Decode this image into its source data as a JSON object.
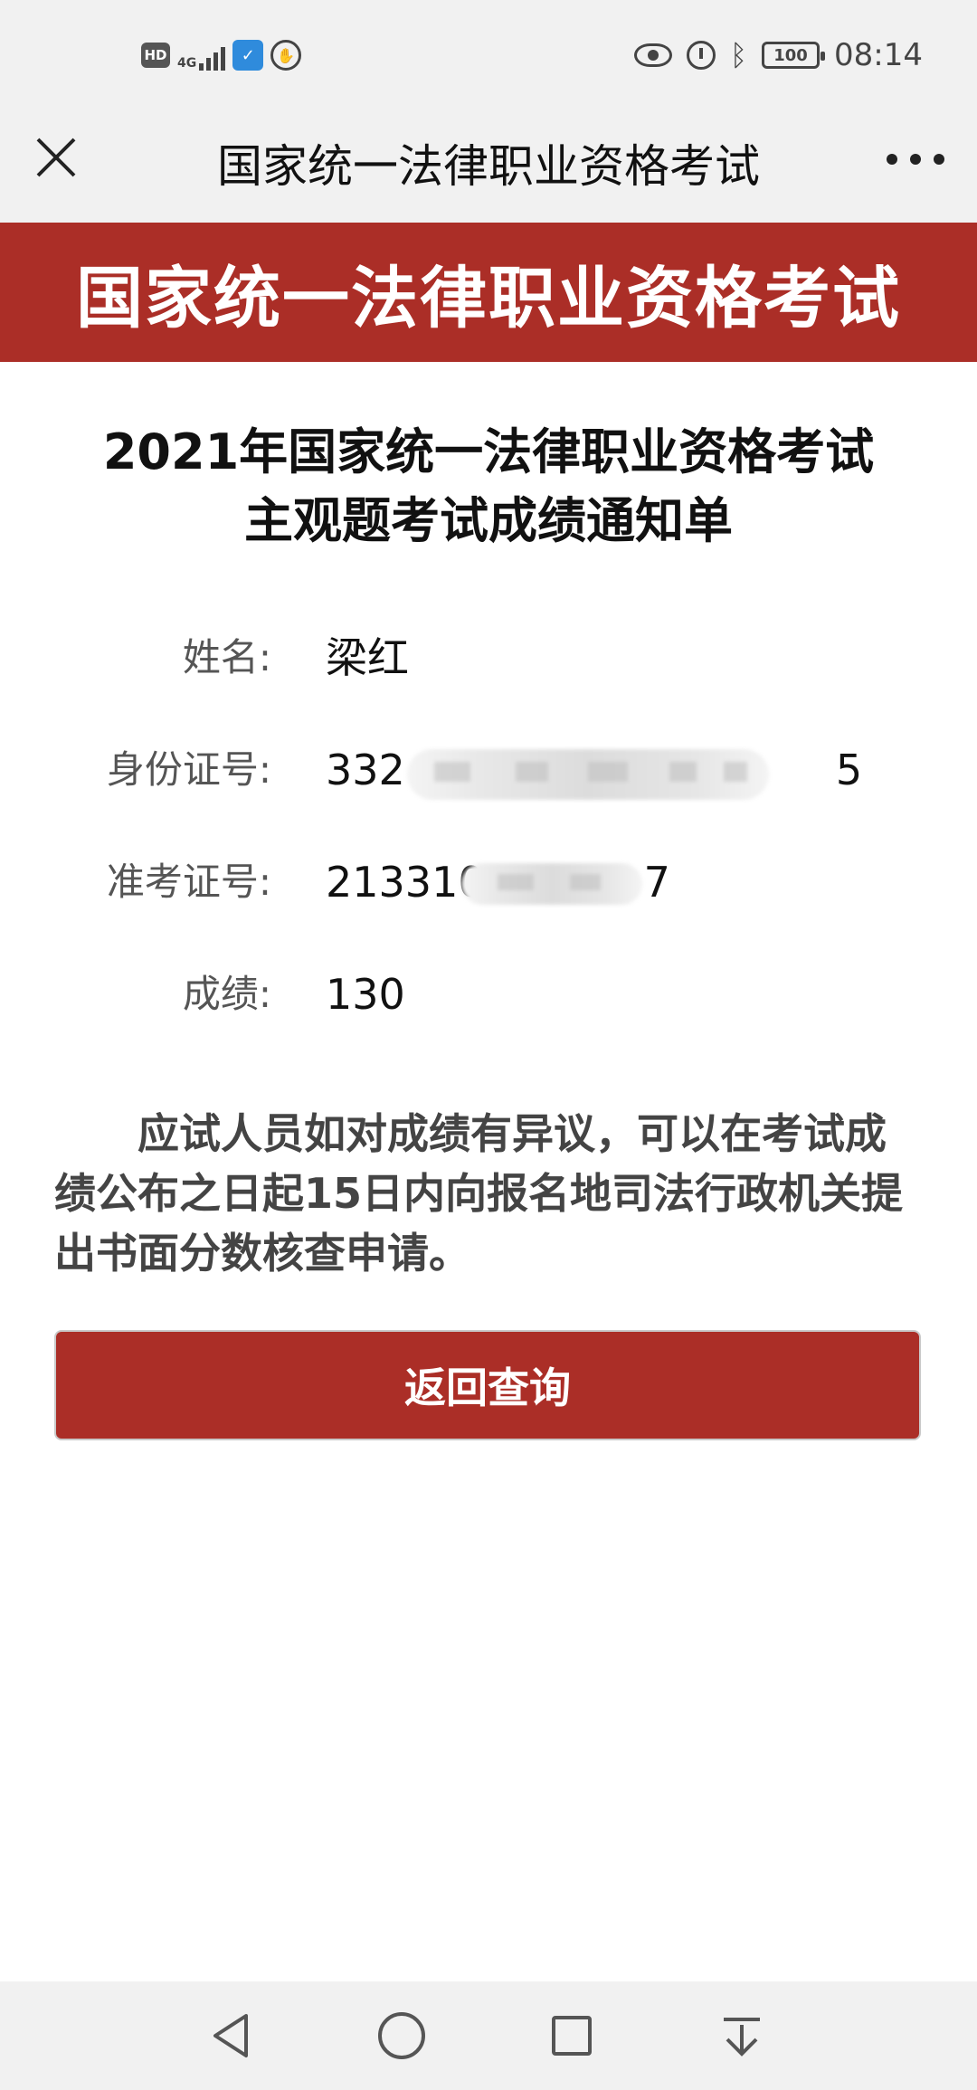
{
  "status_bar": {
    "hd_badge": "HD",
    "network": "4G",
    "battery": "100",
    "time": "08:14",
    "icons": [
      "hd-icon",
      "signal-icon",
      "shield-app-icon",
      "hand-icon",
      "eye-icon",
      "alarm-icon",
      "bluetooth-icon",
      "battery-icon"
    ]
  },
  "nav_bar": {
    "title": "国家统一法律职业资格考试"
  },
  "banner": {
    "title": "国家统一法律职业资格考试"
  },
  "document": {
    "title_line1": "2021年国家统一法律职业资格考试",
    "title_line2": "主观题考试成绩通知单"
  },
  "fields": {
    "name": {
      "label": "姓名:",
      "value": "梁红"
    },
    "id_number": {
      "label": "身份证号:",
      "value_visible": "332",
      "value_tail": "5"
    },
    "admission_number": {
      "label": "准考证号:",
      "value_visible": "213310",
      "value_tail": "7"
    },
    "score": {
      "label": "成绩:",
      "value": "130"
    }
  },
  "notice": {
    "text": "应试人员如对成绩有异议，可以在考试成绩公布之日起15日内向报名地司法行政机关提出书面分数核查申请。"
  },
  "actions": {
    "back_label": "返回查询"
  },
  "colors": {
    "brand_red": "#ab2e27",
    "bar_gray": "#f1f1f1"
  }
}
